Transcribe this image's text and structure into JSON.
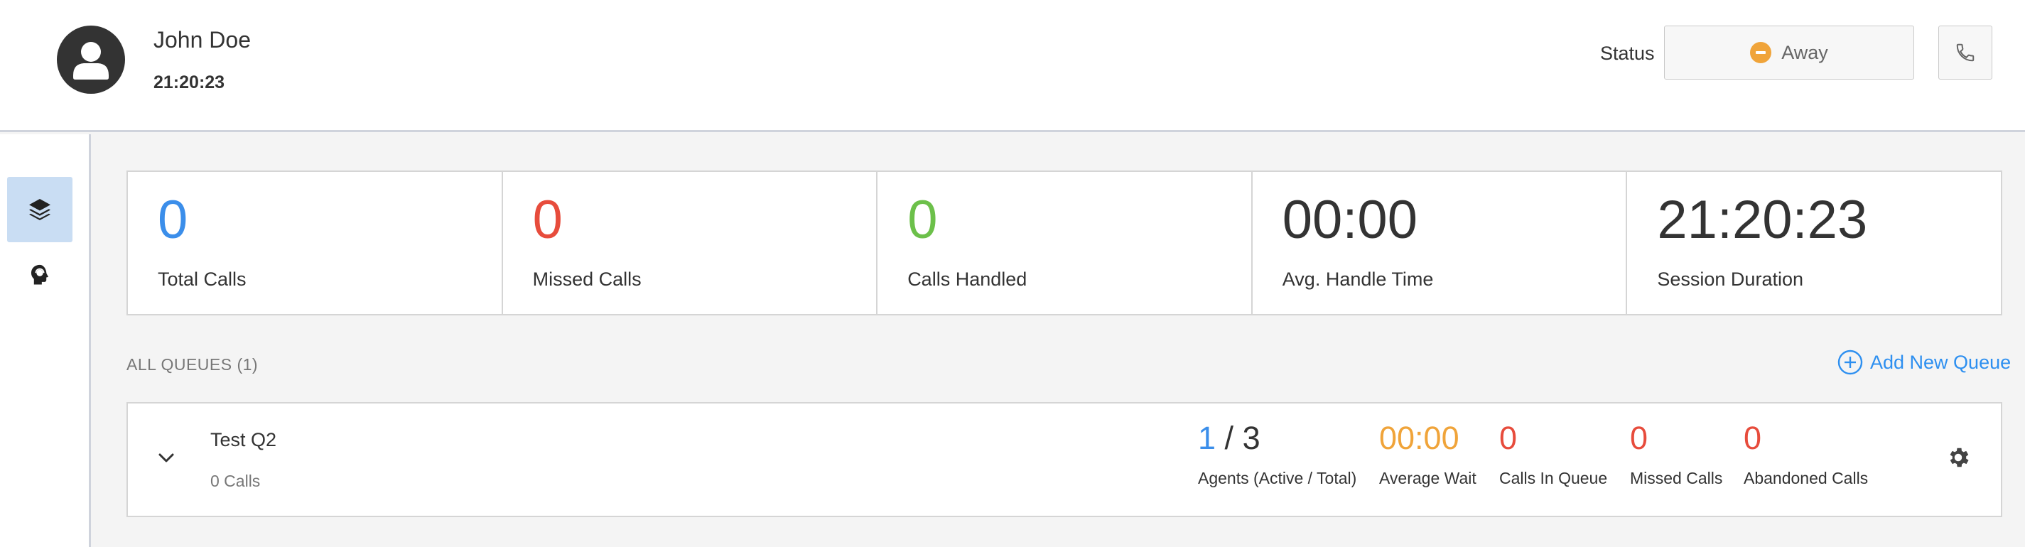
{
  "header": {
    "user_name": "John Doe",
    "time": "21:20:23",
    "status_label": "Status",
    "status_value": "Away",
    "status_color": "#f0a43a",
    "avatar_icon": "user-avatar-icon",
    "call_icon": "phone-icon"
  },
  "sidebar": {
    "items": [
      {
        "icon": "layers-icon",
        "active": true
      },
      {
        "icon": "agent-headset-icon",
        "active": false
      }
    ]
  },
  "stats": [
    {
      "value": "0",
      "label": "Total Calls",
      "color": "#3b8eea"
    },
    {
      "value": "0",
      "label": "Missed Calls",
      "color": "#e74c3c"
    },
    {
      "value": "0",
      "label": "Calls Handled",
      "color": "#6cc04a"
    },
    {
      "value": "00:00",
      "label": "Avg. Handle Time",
      "color": "#333333"
    },
    {
      "value": "21:20:23",
      "label": "Session Duration",
      "color": "#333333"
    }
  ],
  "queues": {
    "heading": "ALL QUEUES (1)",
    "add_label": "Add New Queue",
    "items": [
      {
        "name": "Test Q2",
        "calls": "0 Calls",
        "agents_active": "1",
        "agents_sep": "/",
        "agents_total": "3",
        "agents_label": "Agents (Active / Total)",
        "avg_wait": "00:00",
        "avg_wait_label": "Average Wait",
        "in_queue": "0",
        "in_queue_label": "Calls In Queue",
        "missed": "0",
        "missed_label": "Missed Calls",
        "abandoned": "0",
        "abandoned_label": "Abandoned Calls"
      }
    ]
  },
  "colors": {
    "accent": "#2d8ff0",
    "active_blue": "#3b8eea",
    "warning": "#f0a43a",
    "danger": "#e74c3c",
    "success": "#6cc04a"
  }
}
